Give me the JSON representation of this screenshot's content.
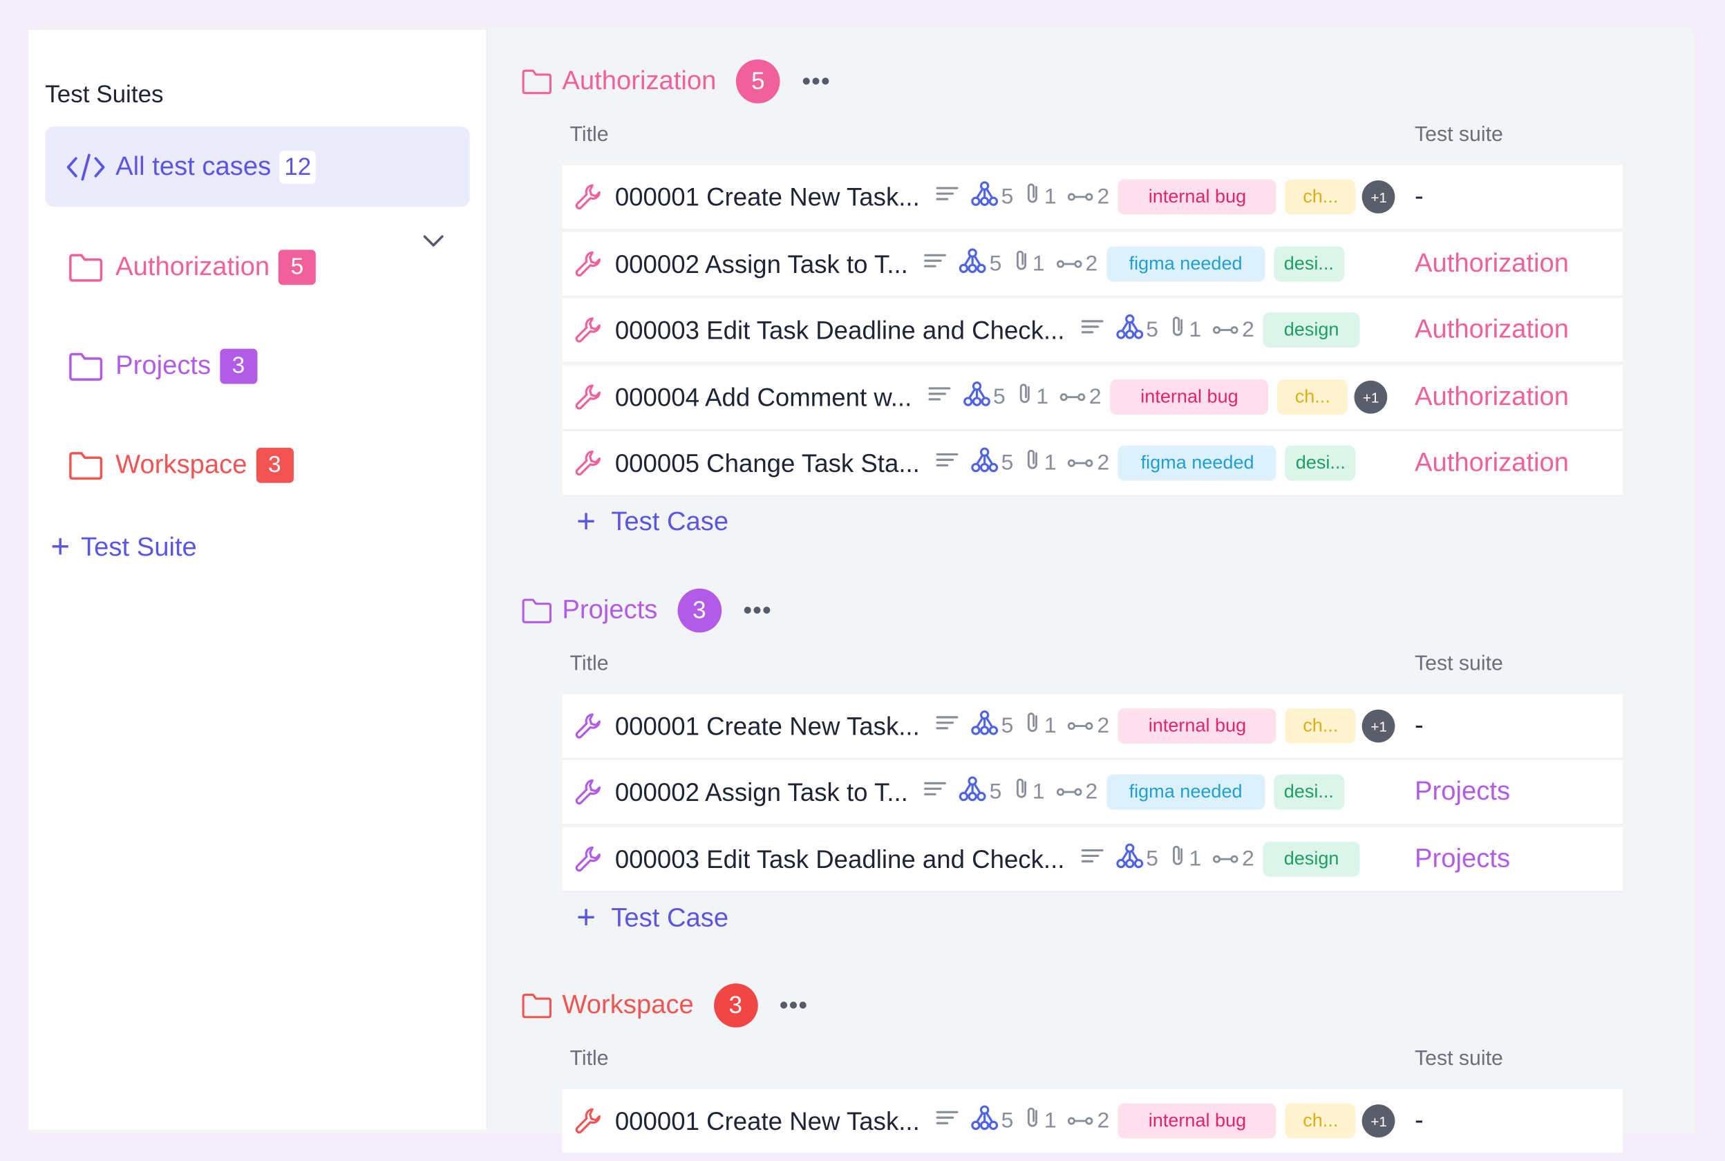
{
  "sidebar": {
    "title": "Test Suites",
    "all_cases": {
      "label": "All test cases",
      "count": "12"
    },
    "items": [
      {
        "label": "Authorization",
        "count": "5",
        "color": "#f0619c"
      },
      {
        "label": "Projects",
        "count": "3",
        "color": "#b25be6"
      },
      {
        "label": "Workspace",
        "count": "3",
        "color": "#f25454"
      }
    ],
    "add_label": "Test Suite"
  },
  "columns": {
    "title": "Title",
    "suite": "Test suite"
  },
  "add_case_label": "Test Case",
  "sections": [
    {
      "name": "Authorization",
      "count": "5",
      "color": "#f0619c",
      "badge": "#f0619c",
      "rows": [
        {
          "title": "000001 Create New Task...",
          "m1": "5",
          "m2": "1",
          "m3": "2",
          "tags": [
            "internal bug",
            "ch..."
          ],
          "extra": "+1",
          "suite": "-"
        },
        {
          "title": "000002  Assign Task to T...",
          "m1": "5",
          "m2": "1",
          "m3": "2",
          "tags": [
            "figma needed",
            "desi..."
          ],
          "suite": "Authorization"
        },
        {
          "title": "000003  Edit Task Deadline and Check...",
          "m1": "5",
          "m2": "1",
          "m3": "2",
          "tags": [
            "design"
          ],
          "suite": "Authorization"
        },
        {
          "title": "000004  Add Comment w...",
          "m1": "5",
          "m2": "1",
          "m3": "2",
          "tags": [
            "internal bug",
            "ch..."
          ],
          "extra": "+1",
          "suite": "Authorization"
        },
        {
          "title": "000005  Change Task Sta...",
          "m1": "5",
          "m2": "1",
          "m3": "2",
          "tags": [
            "figma needed",
            "desi..."
          ],
          "suite": "Authorization"
        }
      ]
    },
    {
      "name": "Projects",
      "count": "3",
      "color": "#b25be6",
      "badge": "#b25be6",
      "rows": [
        {
          "title": "000001 Create New Task...",
          "m1": "5",
          "m2": "1",
          "m3": "2",
          "tags": [
            "internal bug",
            "ch..."
          ],
          "extra": "+1",
          "suite": "-"
        },
        {
          "title": "000002  Assign Task to T...",
          "m1": "5",
          "m2": "1",
          "m3": "2",
          "tags": [
            "figma needed",
            "desi..."
          ],
          "suite": "Projects"
        },
        {
          "title": "000003  Edit Task Deadline and Check...",
          "m1": "5",
          "m2": "1",
          "m3": "2",
          "tags": [
            "design"
          ],
          "suite": "Projects"
        }
      ]
    },
    {
      "name": "Workspace",
      "count": "3",
      "color": "#f25454",
      "badge": "#f04646",
      "rows": [
        {
          "title": "000001 Create New Task...",
          "m1": "5",
          "m2": "1",
          "m3": "2",
          "tags": [
            "internal bug",
            "ch..."
          ],
          "extra": "+1",
          "suite": "-"
        }
      ]
    }
  ],
  "tag_colors": {
    "internal bug": {
      "bg": "#ffe0ec",
      "fg": "#e5236b"
    },
    "ch...": {
      "bg": "#fff4cf",
      "fg": "#e0ae14"
    },
    "figma needed": {
      "bg": "#dcf1fb",
      "fg": "#1f9fd6"
    },
    "desi...": {
      "bg": "#dcf5ea",
      "fg": "#1f9e64"
    },
    "design": {
      "bg": "#dcf5ea",
      "fg": "#1f9e64"
    }
  },
  "icons": {
    "all": "code-icon",
    "folder": "folder-icon",
    "case": "wrench-icon",
    "desc": "description-lines-icon",
    "steps": "hierarchy-icon",
    "attach": "paperclip-icon",
    "links": "link-icon",
    "more": "more-dots-icon",
    "expand": "chevron-down-icon"
  }
}
